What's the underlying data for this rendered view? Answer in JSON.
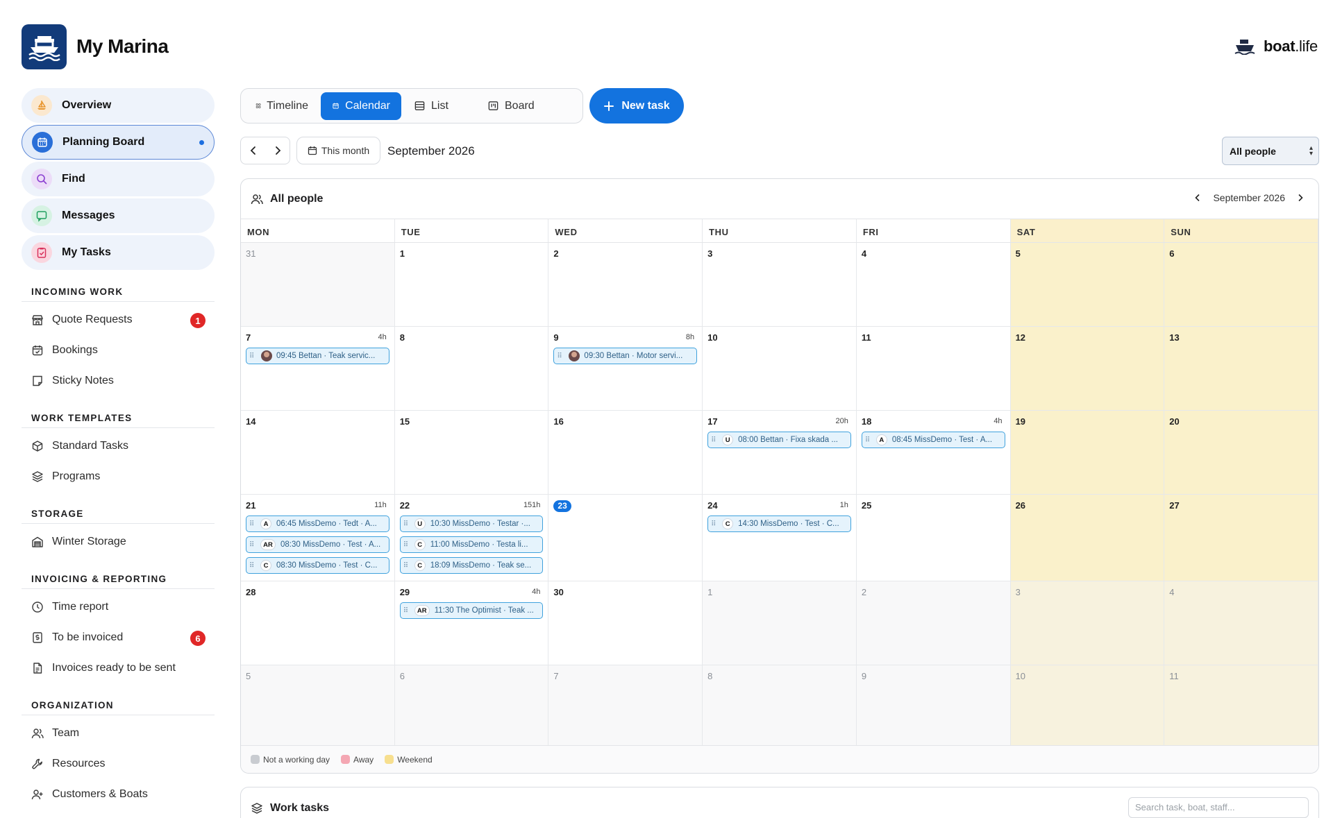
{
  "app": {
    "title": "My Marina",
    "brand_bold": "boat",
    "brand_light": ".life"
  },
  "nav": {
    "pills": [
      {
        "label": "Overview",
        "icon": "sailboat-icon",
        "color": "#e8942c",
        "bg": "#fbe8cf"
      },
      {
        "label": "Planning Board",
        "icon": "calendar-icon",
        "color": "#ffffff",
        "bg": "#2a6fd8",
        "active": true
      },
      {
        "label": "Find",
        "icon": "search-icon",
        "color": "#8b3fd1",
        "bg": "#ecdcf8"
      },
      {
        "label": "Messages",
        "icon": "chat-icon",
        "color": "#20a060",
        "bg": "#d6f2e3"
      },
      {
        "label": "My Tasks",
        "icon": "clipboard-check-icon",
        "color": "#d8315b",
        "bg": "#fad6df"
      }
    ],
    "sections": [
      {
        "title": "INCOMING WORK",
        "items": [
          {
            "label": "Quote Requests",
            "icon": "storefront-icon",
            "badge": "1"
          },
          {
            "label": "Bookings",
            "icon": "calendar-check-icon"
          },
          {
            "label": "Sticky Notes",
            "icon": "note-icon"
          }
        ]
      },
      {
        "title": "WORK TEMPLATES",
        "items": [
          {
            "label": "Standard Tasks",
            "icon": "cube-icon"
          },
          {
            "label": "Programs",
            "icon": "layers-icon"
          }
        ]
      },
      {
        "title": "STORAGE",
        "items": [
          {
            "label": "Winter Storage",
            "icon": "warehouse-icon"
          }
        ]
      },
      {
        "title": "INVOICING & REPORTING",
        "items": [
          {
            "label": "Time report",
            "icon": "clock-icon"
          },
          {
            "label": "To be invoiced",
            "icon": "dollar-doc-icon",
            "badge": "6"
          },
          {
            "label": "Invoices ready to be sent",
            "icon": "document-icon"
          }
        ]
      },
      {
        "title": "ORGANIZATION",
        "items": [
          {
            "label": "Team",
            "icon": "users-icon"
          },
          {
            "label": "Resources",
            "icon": "wrench-icon"
          },
          {
            "label": "Customers & Boats",
            "icon": "user-plus-icon"
          }
        ]
      }
    ]
  },
  "views": [
    {
      "label": "Timeline",
      "icon": "grid-icon"
    },
    {
      "label": "Calendar",
      "icon": "calendar-icon",
      "active": true
    },
    {
      "label": "List",
      "icon": "list-icon"
    },
    {
      "label": "Board",
      "icon": "board-icon"
    }
  ],
  "new_task_label": "New task",
  "toolbar": {
    "this_month": "This month",
    "current_month": "September 2026",
    "people_filter": "All people"
  },
  "calendar": {
    "title": "All people",
    "month_label": "September 2026",
    "weekdays": [
      "MON",
      "TUE",
      "WED",
      "THU",
      "FRI",
      "SAT",
      "SUN"
    ],
    "weeks": [
      [
        {
          "d": "31",
          "other": true
        },
        {
          "d": "1"
        },
        {
          "d": "2"
        },
        {
          "d": "3"
        },
        {
          "d": "4"
        },
        {
          "d": "5"
        },
        {
          "d": "6"
        }
      ],
      [
        {
          "d": "7",
          "hrs": "4h",
          "events": [
            {
              "avatar": true,
              "text": "09:45 Bettan · Teak servic..."
            }
          ]
        },
        {
          "d": "8"
        },
        {
          "d": "9",
          "hrs": "8h",
          "events": [
            {
              "avatar": true,
              "text": "09:30 Bettan · Motor servi..."
            }
          ]
        },
        {
          "d": "10"
        },
        {
          "d": "11"
        },
        {
          "d": "12"
        },
        {
          "d": "13"
        }
      ],
      [
        {
          "d": "14"
        },
        {
          "d": "15"
        },
        {
          "d": "16"
        },
        {
          "d": "17",
          "hrs": "20h",
          "events": [
            {
              "chip": "U",
              "text": "08:00 Bettan · Fixa skada ..."
            }
          ]
        },
        {
          "d": "18",
          "hrs": "4h",
          "events": [
            {
              "chip": "A",
              "text": "08:45 MissDemo · Test · A..."
            }
          ]
        },
        {
          "d": "19"
        },
        {
          "d": "20"
        }
      ],
      [
        {
          "d": "21",
          "hrs": "11h",
          "events": [
            {
              "chip": "A",
              "text": "06:45 MissDemo · Tedt · A..."
            },
            {
              "chip": "AR",
              "text": "08:30 MissDemo · Test · A..."
            },
            {
              "chip": "C",
              "text": "08:30 MissDemo · Test · C..."
            }
          ]
        },
        {
          "d": "22",
          "hrs": "151h",
          "events": [
            {
              "chip": "U",
              "text": "10:30 MissDemo · Testar ·..."
            },
            {
              "chip": "C",
              "text": "11:00 MissDemo · Testa li..."
            },
            {
              "chip": "C",
              "text": "18:09 MissDemo · Teak se..."
            }
          ]
        },
        {
          "d": "23",
          "today": true
        },
        {
          "d": "24",
          "hrs": "1h",
          "events": [
            {
              "chip": "C",
              "text": "14:30 MissDemo · Test · C..."
            }
          ]
        },
        {
          "d": "25"
        },
        {
          "d": "26"
        },
        {
          "d": "27"
        }
      ],
      [
        {
          "d": "28"
        },
        {
          "d": "29",
          "hrs": "4h",
          "events": [
            {
              "chip": "AR",
              "text": "11:30 The Optimist · Teak ..."
            }
          ]
        },
        {
          "d": "30"
        },
        {
          "d": "1",
          "other": true
        },
        {
          "d": "2",
          "other": true
        },
        {
          "d": "3",
          "other": true
        },
        {
          "d": "4",
          "other": true
        }
      ],
      [
        {
          "d": "5",
          "other": true
        },
        {
          "d": "6",
          "other": true
        },
        {
          "d": "7",
          "other": true
        },
        {
          "d": "8",
          "other": true
        },
        {
          "d": "9",
          "other": true
        },
        {
          "d": "10",
          "other": true
        },
        {
          "d": "11",
          "other": true
        }
      ]
    ],
    "legend": [
      {
        "label": "Not a working day",
        "color": "#c9ccd1"
      },
      {
        "label": "Away",
        "color": "#f4a7b3"
      },
      {
        "label": "Weekend",
        "color": "#f7df8f"
      }
    ]
  },
  "work_tasks": {
    "title": "Work tasks",
    "search_placeholder": "Search task, boat, staff..."
  }
}
